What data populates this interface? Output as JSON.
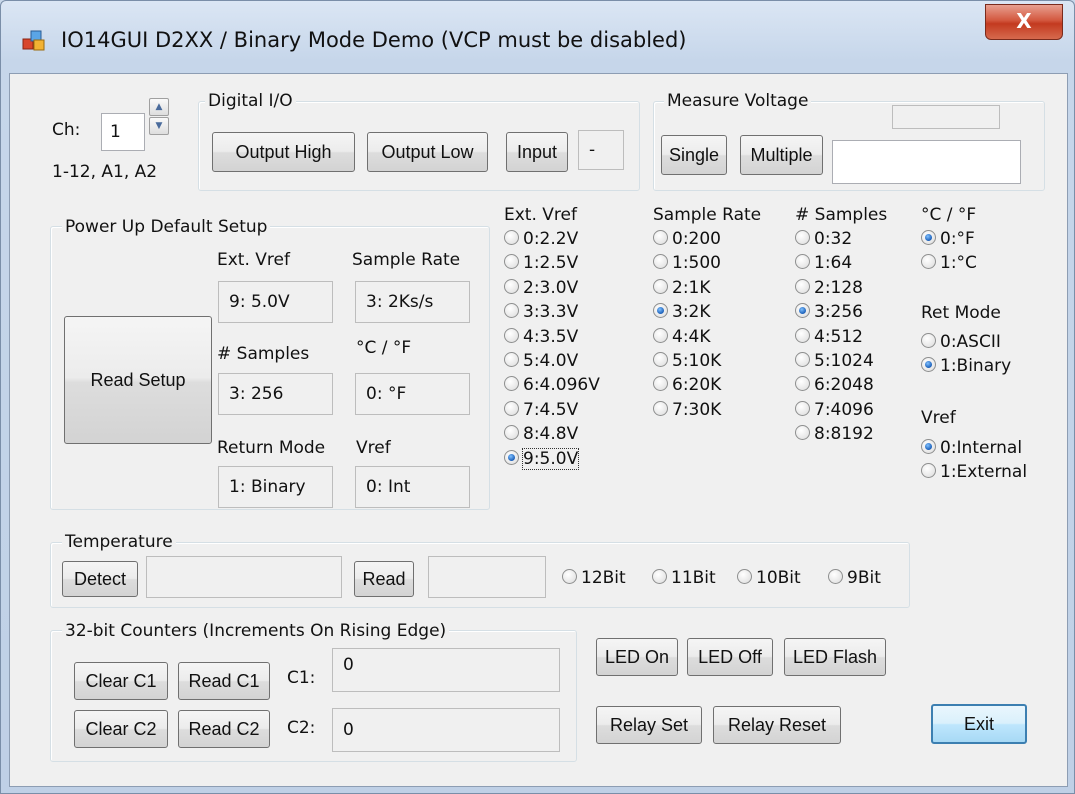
{
  "window": {
    "title": "IO14GUI  D2XX / Binary Mode Demo (VCP must be disabled)",
    "close_label": "X"
  },
  "channel": {
    "label": "Ch:",
    "value": "1",
    "range": "1-12, A1, A2"
  },
  "digital_io": {
    "title": "Digital I/O",
    "output_high": "Output High",
    "output_low": "Output Low",
    "input": "Input",
    "state": "-"
  },
  "measure_voltage": {
    "title": "Measure Voltage",
    "single": "Single",
    "multiple": "Multiple",
    "top_value": "",
    "result": ""
  },
  "power_up": {
    "title": "Power Up Default Setup",
    "read_setup": "Read Setup",
    "ext_vref_label": "Ext. Vref",
    "ext_vref_value": "9: 5.0V",
    "sample_rate_label": "Sample Rate",
    "sample_rate_value": "3: 2Ks/s",
    "samples_label": "# Samples",
    "samples_value": "3: 256",
    "temp_unit_label": "°C / °F",
    "temp_unit_value": "0: °F",
    "return_mode_label": "Return Mode",
    "return_mode_value": "1: Binary",
    "vref_label": "Vref",
    "vref_value": "0: Int"
  },
  "ext_vref": {
    "title": "Ext. Vref",
    "options": [
      "0:2.2V",
      "1:2.5V",
      "2:3.0V",
      "3:3.3V",
      "4:3.5V",
      "5:4.0V",
      "6:4.096V",
      "7:4.5V",
      "8:4.8V",
      "9:5.0V"
    ],
    "selected": "9:5.0V"
  },
  "sample_rate": {
    "title": "Sample Rate",
    "options": [
      "0:200",
      "1:500",
      "2:1K",
      "3:2K",
      "4:4K",
      "5:10K",
      "6:20K",
      "7:30K"
    ],
    "selected": "3:2K"
  },
  "num_samples": {
    "title": "# Samples",
    "options": [
      "0:32",
      "1:64",
      "2:128",
      "3:256",
      "4:512",
      "5:1024",
      "6:2048",
      "7:4096",
      "8:8192"
    ],
    "selected": "3:256"
  },
  "temp_unit": {
    "title": "°C / °F",
    "options": [
      "0:°F",
      "1:°C"
    ],
    "selected": "0:°F"
  },
  "ret_mode": {
    "title": "Ret Mode",
    "options": [
      "0:ASCII",
      "1:Binary"
    ],
    "selected": "1:Binary"
  },
  "vref": {
    "title": "Vref",
    "options": [
      "0:Internal",
      "1:External"
    ],
    "selected": "0:Internal"
  },
  "temperature": {
    "title": "Temperature",
    "detect": "Detect",
    "detect_value": "",
    "read": "Read",
    "read_value": "",
    "resolutions": [
      "12Bit",
      "11Bit",
      "10Bit",
      "9Bit"
    ]
  },
  "counters": {
    "title": "32-bit Counters (Increments On Rising Edge)",
    "clear_c1": "Clear C1",
    "read_c1": "Read C1",
    "c1_label": "C1:",
    "c1_value": "0",
    "clear_c2": "Clear C2",
    "read_c2": "Read C2",
    "c2_label": "C2:",
    "c2_value": "0"
  },
  "led": {
    "on": "LED On",
    "off": "LED Off",
    "flash": "LED Flash"
  },
  "relay": {
    "set": "Relay Set",
    "reset": "Relay Reset"
  },
  "exit": "Exit"
}
